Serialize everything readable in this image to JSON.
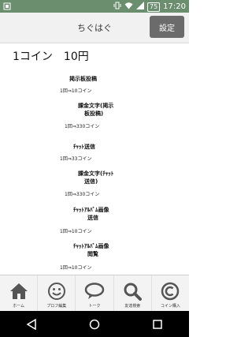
{
  "status_bar": {
    "battery": "75",
    "time": "17:20"
  },
  "header": {
    "title": "ちぐはぐ",
    "settings_label": "設定"
  },
  "content": {
    "price_heading": "1コイン　10円",
    "items": [
      {
        "name_lines": [
          "掲示板投稿"
        ],
        "price": "1回⇒10コイン"
      },
      {
        "name_lines": [
          "課金文字(掲示",
          "板投稿)"
        ],
        "price": "1回⇒330コイン"
      },
      {
        "name_lines": [
          "ﾁｬｯﾄ送信"
        ],
        "price": "1回⇒33コイン"
      },
      {
        "name_lines": [
          "課金文字(ﾁｬｯﾄ",
          "送信)"
        ],
        "price": "1回⇒330コイン"
      },
      {
        "name_lines": [
          "ﾁｬｯﾄｱﾙﾊﾞﾑ画像",
          "送信"
        ],
        "price": "1回⇒10コイン"
      },
      {
        "name_lines": [
          "ﾁｬｯﾄｱﾙﾊﾞﾑ画像",
          "閲覧"
        ],
        "price": "1回⇒10コイン"
      }
    ]
  },
  "bottom_nav": [
    {
      "label": "ホーム",
      "icon": "home-icon"
    },
    {
      "label": "プロフ編集",
      "icon": "smiley-icon"
    },
    {
      "label": "トーク",
      "icon": "speech-bubble-icon"
    },
    {
      "label": "友達検索",
      "icon": "magnifier-icon"
    },
    {
      "label": "コイン購入",
      "icon": "coin-icon"
    }
  ],
  "colors": {
    "status_bar": "#6b8e6f",
    "header_bg": "#f1f1f1",
    "settings_button": "#6b6b6b",
    "nav_icon": "#555555"
  }
}
